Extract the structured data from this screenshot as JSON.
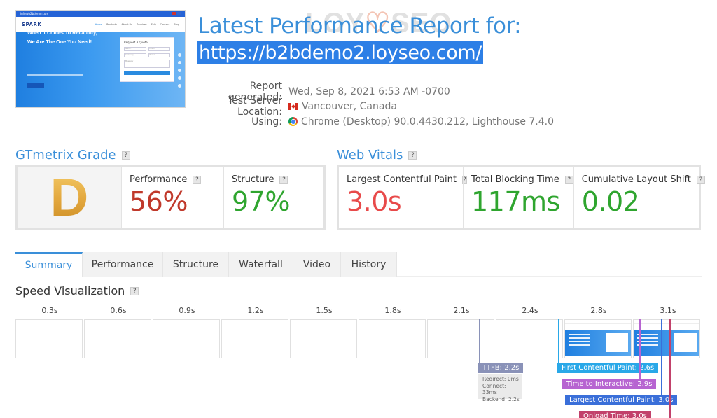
{
  "thumbnail": {
    "email": "info@b2bdemo.com",
    "logo": "SPARK",
    "nav": [
      "Home",
      "Products",
      "About Us",
      "Services",
      "FAQ",
      "Contact",
      "Blog"
    ],
    "hero_text": "When It Comes To Reliability, We Are The One You Need!",
    "quote_title": "Request A Quote",
    "fields": [
      "Name *",
      "Email *",
      "Company",
      "Phone",
      "Message *"
    ]
  },
  "header": {
    "title": "Latest Performance Report for:",
    "url": "https://b2bdemo2.loyseo.com/",
    "watermark": "LOYSEO"
  },
  "meta": {
    "rows": [
      {
        "label": "Report generated:",
        "value": "Wed, Sep 8, 2021 6:53 AM -0700"
      },
      {
        "label": "Test Server Location:",
        "value": "Vancouver, Canada",
        "icon": "canada-flag-icon"
      },
      {
        "label": "Using:",
        "value": "Chrome (Desktop) 90.0.4430.212, Lighthouse 7.4.0",
        "icon": "chrome-icon"
      }
    ]
  },
  "grade": {
    "heading": "GTmetrix Grade",
    "help": "?",
    "letter": "D",
    "performance_label": "Performance",
    "performance_value": "56%",
    "structure_label": "Structure",
    "structure_value": "97%"
  },
  "vitals": {
    "heading": "Web Vitals",
    "help": "?",
    "lcp_label": "Largest Contentful Paint",
    "lcp_value": "3.0s",
    "tbt_label": "Total Blocking Time",
    "tbt_value": "117ms",
    "cls_label": "Cumulative Layout Shift",
    "cls_value": "0.02"
  },
  "tabs": [
    "Summary",
    "Performance",
    "Structure",
    "Waterfall",
    "Video",
    "History"
  ],
  "active_tab": "Summary",
  "speed": {
    "heading": "Speed Visualization",
    "help": "?",
    "times": [
      "0.3s",
      "0.6s",
      "0.9s",
      "1.2s",
      "1.5s",
      "1.8s",
      "2.1s",
      "2.4s",
      "2.8s",
      "3.1s"
    ],
    "ttfb": "TTFB: 2.2s",
    "redirect": "Redirect: 0ms",
    "connect": "Connect: 33ms",
    "backend": "Backend: 2.2s",
    "fcp": "First Contentful Paint: 2.6s",
    "tti": "Time to Interactive: 2.9s",
    "lcp": "Largest Contentful Paint: 3.0s",
    "onload": "Onload Time: 3.0s"
  },
  "colors": {
    "accent": "#3a8fd9",
    "grade_d": "#e2a63c",
    "performance": "#c0392b",
    "good": "#2fa52f",
    "lcp_bad": "#e84a4a",
    "ttfb": "#8a92b8",
    "fcp": "#29a8e8",
    "tti": "#b764d1",
    "lcp_marker": "#3a6fd9",
    "onload": "#c2416b"
  }
}
